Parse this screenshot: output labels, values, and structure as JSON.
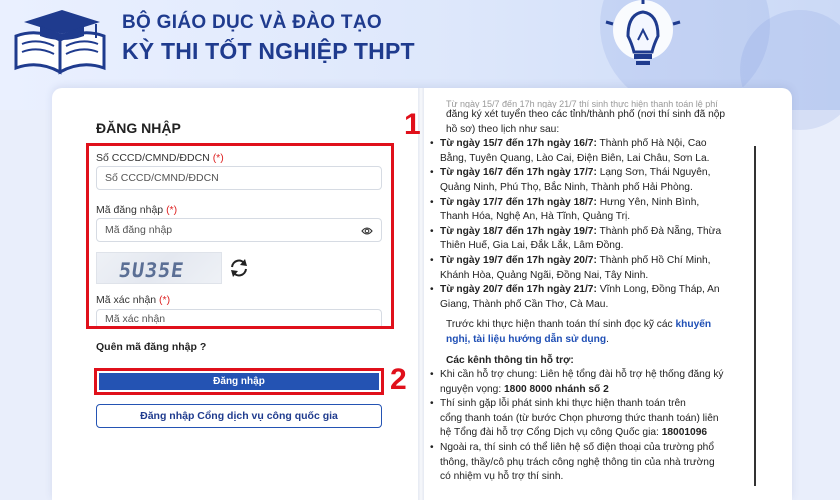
{
  "header": {
    "org": "BỘ GIÁO DỤC VÀ ĐÀO TẠO",
    "exam": "KỲ THI TỐT NGHIỆP THPT"
  },
  "login": {
    "title": "ĐĂNG NHẬP",
    "id_label": "Số CCCD/CMND/ĐDCN",
    "id_placeholder": "Số CCCD/CMND/ĐDCN",
    "code_label": "Mã đăng nhập",
    "code_placeholder": "Mã đăng nhập",
    "captcha_text": "5U35E",
    "verify_label": "Mã xác nhận",
    "verify_placeholder": "Mã xác nhận",
    "required_mark": "(*)",
    "forgot": "Quên mã đăng nhập ?",
    "login_button": "Đăng nhập",
    "portal_button": "Đăng nhập Cổng dịch vụ công quốc gia"
  },
  "annotations": {
    "step1": "1",
    "step2": "2"
  },
  "info": {
    "intro_faded": "Từ ngày 15/7 đến 17h ngày 21/7 thí sinh thực hiện thanh toán lệ phí",
    "intro_1": "đăng ký xét tuyển theo các tỉnh/thành phố (nơi thí sinh đã nộp",
    "intro_2": "hồ sơ) theo lịch như sau:",
    "schedule": [
      {
        "date": "Từ ngày 15/7 đến 17h ngày 16/7:",
        "line1": " Thành phố Hà Nội, Cao",
        "line2": "Bằng, Tuyên Quang, Lào Cai, Điện Biên, Lai Châu, Sơn La."
      },
      {
        "date": "Từ ngày 16/7 đến 17h ngày 17/7:",
        "line1": " Lạng Sơn, Thái Nguyên,",
        "line2": "Quảng Ninh, Phú Thọ, Bắc Ninh, Thành phố Hải Phòng."
      },
      {
        "date": "Từ ngày 17/7 đến 17h ngày 18/7:",
        "line1": " Hưng Yên, Ninh Bình,",
        "line2": "Thanh Hóa, Nghệ An, Hà Tĩnh, Quảng Trị."
      },
      {
        "date": "Từ ngày 18/7 đến 17h ngày 19/7:",
        "line1": " Thành phố Đà Nẵng, Thừa",
        "line2": "Thiên Huế, Gia Lai, Đắk Lắk, Lâm Đồng."
      },
      {
        "date": "Từ ngày 19/7 đến 17h ngày 20/7:",
        "line1": " Thành phố Hồ Chí Minh,",
        "line2": "Khánh Hòa, Quảng Ngãi, Đồng Nai, Tây Ninh."
      },
      {
        "date": "Từ ngày 20/7 đến 17h ngày 21/7:",
        "line1": " Vĩnh Long, Đồng Tháp, An",
        "line2": "Giang, Thành phố Cần Thơ, Cà Mau."
      }
    ],
    "pay_1": "Trước khi thực hiện thanh toán thí sinh đọc kỹ các ",
    "pay_link1": "khuyến",
    "pay_link2": "nghị, tài liệu hướng dẫn sử dụng",
    "pay_end": ".",
    "support_title": "Các kênh thông tin hỗ trợ:",
    "support_1a": "Khi cần hỗ trợ chung: Liên hệ tổng đài hỗ trợ hệ thống đăng ký",
    "support_1b": "nguyện vọng: ",
    "support_1c": "1800 8000 nhánh số 2",
    "support_2a": "Thí sinh gặp lỗi phát sinh khi thực hiện thanh toán trên",
    "support_2b": "cổng thanh toán (từ bước Chọn phương thức thanh toán) liên",
    "support_2c": "hệ Tổng đài hỗ trợ Cổng Dịch vụ công Quốc gia: ",
    "support_2d": "18001096",
    "support_3a": "Ngoài ra, thí sinh có thể liên hệ số điện thoại của trường phổ",
    "support_3b": "thông, thầy/cô phụ trách công nghệ thông tin của nhà trường",
    "support_3c": "có nhiệm vụ hỗ trợ thí sinh."
  }
}
